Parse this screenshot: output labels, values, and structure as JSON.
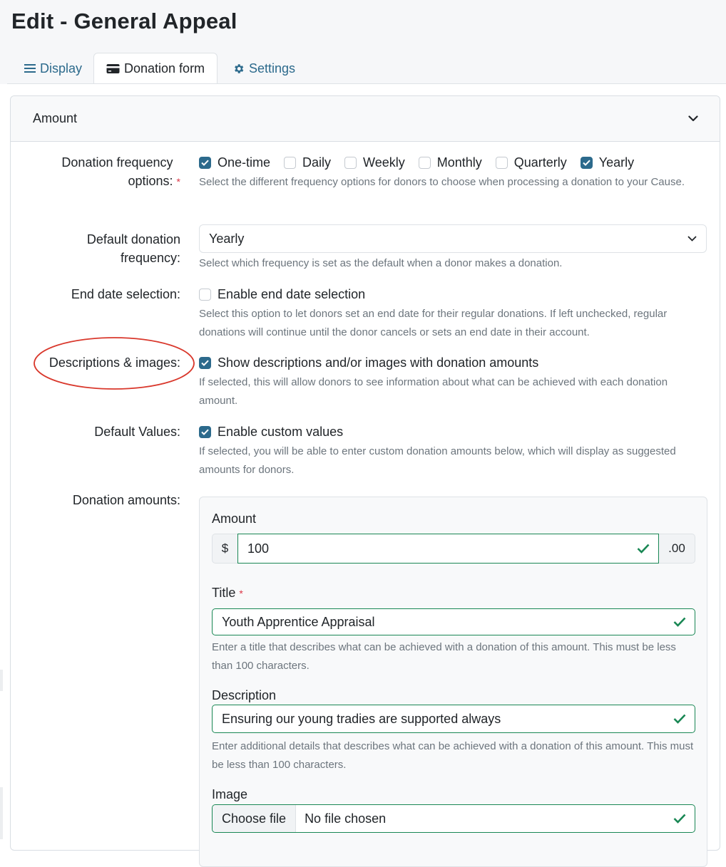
{
  "page": {
    "title": "Edit - General Appeal"
  },
  "tabs": [
    {
      "label": "Display",
      "icon": "list-icon"
    },
    {
      "label": "Donation form",
      "icon": "credit-card-icon"
    },
    {
      "label": "Settings",
      "icon": "gear-icon"
    }
  ],
  "section": {
    "title": "Amount",
    "icon": "chevron-down-icon"
  },
  "frequency": {
    "label": "Donation frequency options:",
    "required_mark": "*",
    "options": [
      {
        "label": "One-time",
        "checked": true
      },
      {
        "label": "Daily",
        "checked": false
      },
      {
        "label": "Weekly",
        "checked": false
      },
      {
        "label": "Monthly",
        "checked": false
      },
      {
        "label": "Quarterly",
        "checked": false
      },
      {
        "label": "Yearly",
        "checked": true
      }
    ],
    "help": "Select the different frequency options for donors to choose when processing a donation to your Cause."
  },
  "default_frequency": {
    "label": "Default donation frequency:",
    "value": "Yearly",
    "help": "Select which frequency is set as the default when a donor makes a donation."
  },
  "end_date": {
    "label": "End date selection:",
    "checkbox_label": "Enable end date selection",
    "checked": false,
    "help": "Select this option to let donors set an end date for their regular donations. If left unchecked, regular donations will continue until the donor cancels or sets an end date in their account."
  },
  "descriptions": {
    "label": "Descriptions & images:",
    "checkbox_label": "Show descriptions and/or images with donation amounts",
    "checked": true,
    "help": "If selected, this will allow donors to see information about what can be achieved with each donation amount."
  },
  "default_values": {
    "label": "Default Values:",
    "checkbox_label": "Enable custom values",
    "checked": true,
    "help": "If selected, you will be able to enter custom donation amounts below, which will display as suggested amounts for donors."
  },
  "donation_amounts": {
    "label": "Donation amounts:",
    "amount": {
      "label": "Amount",
      "prefix": "$",
      "value": "100",
      "suffix": ".00"
    },
    "title": {
      "label": "Title",
      "required_mark": "*",
      "value": "Youth Apprentice Appraisal",
      "help": "Enter a title that describes what can be achieved with a donation of this amount. This must be less than 100 characters."
    },
    "description": {
      "label": "Description",
      "value": "Ensuring our young tradies are supported always",
      "help": "Enter additional details that describes what can be achieved with a donation of this amount. This must be less than 100 characters."
    },
    "image": {
      "label": "Image",
      "button": "Choose file",
      "status": "No file chosen"
    }
  },
  "colors": {
    "accent": "#2c6a8c",
    "valid": "#198754",
    "required": "#dc3545",
    "annotation": "#d9382c"
  }
}
